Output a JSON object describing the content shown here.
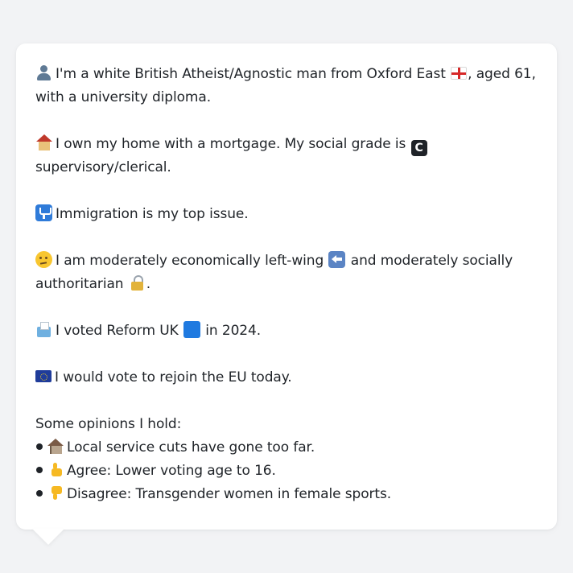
{
  "profile": {
    "intro": {
      "text_before_flag": "I'm a white British Atheist/Agnostic man from Oxford East",
      "text_after_flag": ", aged 61,",
      "text_line2": "with a university diploma."
    },
    "home": {
      "text_before_icon": "I own my home with a mortgage. My social grade is",
      "text_line2": "supervisory/clerical."
    },
    "top_issue": {
      "text": "Immigration is my top issue."
    },
    "ideology": {
      "text_before_arrow": "I am moderately economically left-wing",
      "text_after_arrow": "and moderately socially",
      "text_line2": "authoritarian",
      "text_line2_end": "."
    },
    "vote": {
      "text_before_icon": "I voted Reform UK",
      "text_after_icon": "in 2024."
    },
    "eu": {
      "text": "I would vote to rejoin the EU today."
    },
    "opinions": {
      "heading": "Some opinions I hold:",
      "items": [
        {
          "icon": "derelict-house-icon",
          "text": "Local service cuts have gone too far."
        },
        {
          "icon": "thumbs-up-icon",
          "text": "Agree: Lower voting age to 16."
        },
        {
          "icon": "thumbs-down-icon",
          "text": "Disagree: Transgender women in female sports."
        }
      ]
    },
    "icons": {
      "letter_c": "C"
    },
    "colors": {
      "background": "#f2f3f5",
      "card": "#ffffff",
      "text": "#1f2328",
      "reform_blue": "#1f7ae0"
    }
  }
}
